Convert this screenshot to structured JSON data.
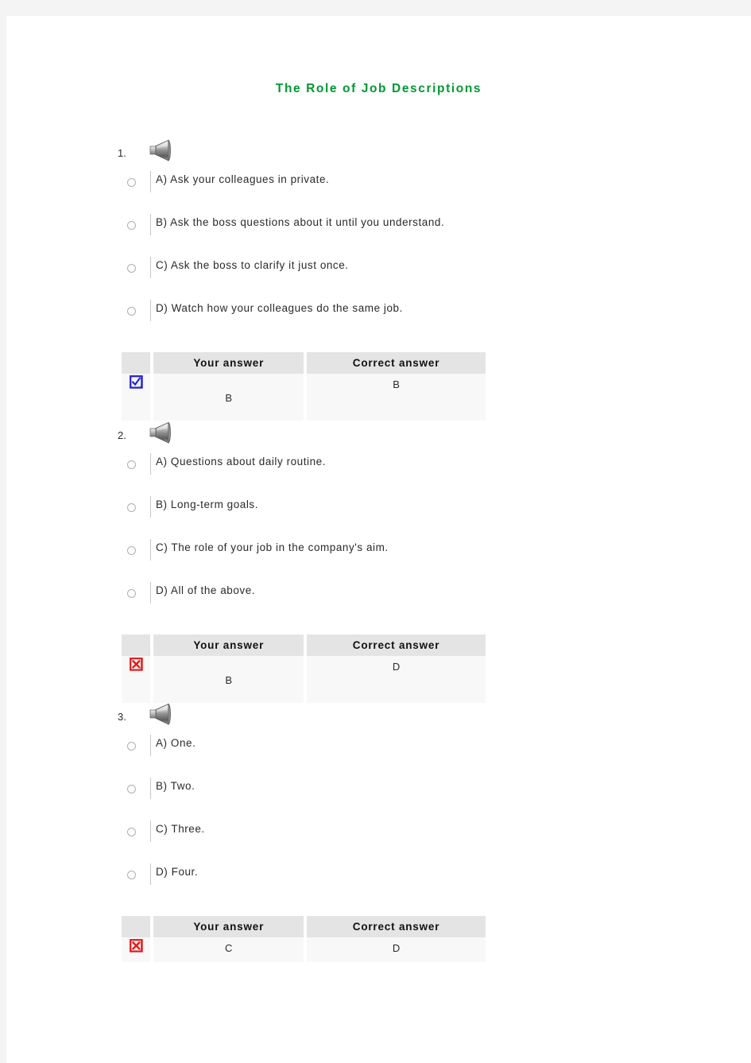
{
  "document": {
    "title": "The Role of Job Descriptions",
    "title_color": "#009933",
    "background_color": "#f4f4f4",
    "page_color": "#ffffff"
  },
  "table_headers": {
    "marker": "",
    "your_answer": "Your answer",
    "correct_answer": "Correct answer"
  },
  "questions": [
    {
      "number": "1.",
      "audio_icon": "speaker-icon",
      "options": [
        {
          "label": "A) Ask your colleagues in private."
        },
        {
          "label": "B) Ask the boss questions about it until you understand."
        },
        {
          "label": "C) Ask the boss to clarify it just once."
        },
        {
          "label": "D) Watch how your colleagues do the same job."
        }
      ],
      "result": {
        "marker_icon": "checkbox-checked-icon",
        "marker_state": "correct",
        "your_answer": "B",
        "correct_answer": "B"
      }
    },
    {
      "number": "2.",
      "audio_icon": "speaker-icon",
      "options": [
        {
          "label": "A) Questions about daily routine."
        },
        {
          "label": "B) Long-term goals."
        },
        {
          "label": "C) The role of your job in the company's aim."
        },
        {
          "label": "D) All of the above."
        }
      ],
      "result": {
        "marker_icon": "cross-incorrect-icon",
        "marker_state": "incorrect",
        "your_answer": "B",
        "correct_answer": "D"
      }
    },
    {
      "number": "3.",
      "audio_icon": "speaker-icon",
      "options": [
        {
          "label": "A) One."
        },
        {
          "label": "B) Two."
        },
        {
          "label": "C) Three."
        },
        {
          "label": "D) Four."
        }
      ],
      "result": {
        "marker_icon": "cross-incorrect-icon",
        "marker_state": "incorrect",
        "your_answer": "C",
        "correct_answer": "D"
      }
    }
  ],
  "colors": {
    "correct_marker": "#2222cc",
    "incorrect_marker": "#e01b1b",
    "header_bg": "#e4e4e4",
    "cell_bg": "#f8f8f8",
    "body_text": "#2a2a2a"
  }
}
